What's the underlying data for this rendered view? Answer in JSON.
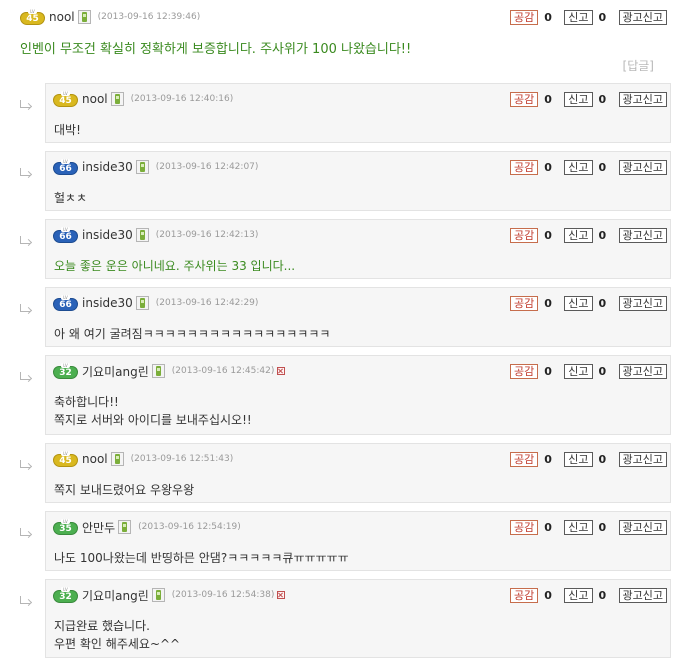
{
  "colors": {
    "badge_gold": "#d9b81f",
    "badge_blue": "#2a62b8",
    "badge_green": "#4caf50",
    "highlight_text": "#3a8a1f",
    "like_border": "#c66d4c"
  },
  "icons": {
    "mobile": "mobile-phone-icon",
    "flag": "flag-x-icon",
    "reply": "reply-arrow-icon"
  },
  "buttons": {
    "like": "공감",
    "report": "신고",
    "ad_report": "광고신고"
  },
  "main": {
    "level": "45",
    "level_tag": "LV",
    "nick": "nool",
    "time": "(2013-09-16 12:39:46)",
    "like_count": "0",
    "report_count": "0",
    "body": "인벤이 무조건 확실히 정확하게 보증합니다. 주사위가 100 나왔습니다!!",
    "reply_label": "[답글]"
  },
  "replies": [
    {
      "level": "45",
      "level_tag": "LV",
      "nick": "nool",
      "time": "(2013-09-16 12:40:16)",
      "like_count": "0",
      "report_count": "0",
      "lines": [
        "대박!"
      ]
    },
    {
      "level": "66",
      "level_tag": "LV",
      "nick": "inside30",
      "time": "(2013-09-16 12:42:07)",
      "like_count": "0",
      "report_count": "0",
      "lines": [
        "헐ㅊㅊ"
      ]
    },
    {
      "level": "66",
      "level_tag": "LV",
      "nick": "inside30",
      "time": "(2013-09-16 12:42:13)",
      "like_count": "0",
      "report_count": "0",
      "lines": [
        "오늘 좋은 운은 아니네요. 주사위는 33 입니다..."
      ]
    },
    {
      "level": "66",
      "level_tag": "LV",
      "nick": "inside30",
      "time": "(2013-09-16 12:42:29)",
      "like_count": "0",
      "report_count": "0",
      "lines": [
        "아 왜 여기 굴려짐ㅋㅋㅋㅋㅋㅋㅋㅋㅋㅋㅋㅋㅋㅋㅋㅋㅋ"
      ]
    },
    {
      "level": "32",
      "level_tag": "LV",
      "nick": "기요미ang린",
      "time": "(2013-09-16 12:45:42)",
      "like_count": "0",
      "report_count": "0",
      "lines": [
        "축하합니다!!",
        "쪽지로 서버와 아이디를 보내주십시오!!"
      ]
    },
    {
      "level": "45",
      "level_tag": "LV",
      "nick": "nool",
      "time": "(2013-09-16 12:51:43)",
      "like_count": "0",
      "report_count": "0",
      "lines": [
        "쪽지 보내드렸어요 우왕우왕"
      ]
    },
    {
      "level": "35",
      "level_tag": "LV",
      "nick": "안만두",
      "time": "(2013-09-16 12:54:19)",
      "like_count": "0",
      "report_count": "0",
      "lines": [
        "나도 100나왔는데 반띵하믄 안댐?ㅋㅋㅋㅋㅋ큐ㅠㅠㅠㅠㅠ"
      ]
    },
    {
      "level": "32",
      "level_tag": "LV",
      "nick": "기요미ang린",
      "time": "(2013-09-16 12:54:38)",
      "like_count": "0",
      "report_count": "0",
      "lines": [
        "지급완료 했습니다.",
        "우편 확인 해주세요~^^"
      ]
    }
  ]
}
